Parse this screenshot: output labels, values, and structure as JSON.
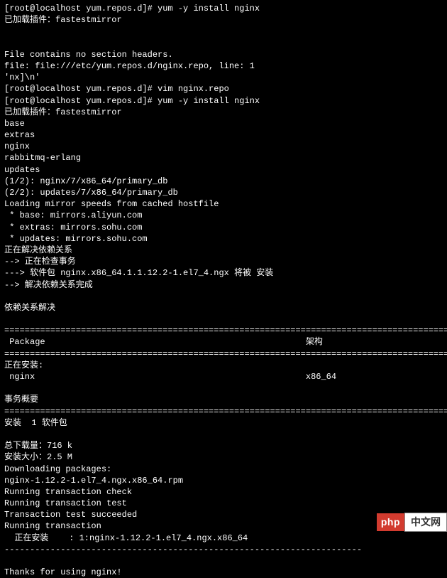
{
  "lines": {
    "l1": "[root@localhost yum.repos.d]# yum -y install nginx",
    "l2": "已加载插件：fastestmirror",
    "l3": "File contains no section headers.",
    "l4": "file: file:///etc/yum.repos.d/nginx.repo, line: 1",
    "l5": "'nx]\\n'",
    "l6": "[root@localhost yum.repos.d]# vim nginx.repo",
    "l7": "[root@localhost yum.repos.d]# yum -y install nginx",
    "l8": "已加载插件：fastestmirror",
    "l9": "base",
    "l10": "extras",
    "l11": "nginx",
    "l12": "rabbitmq-erlang",
    "l13": "updates",
    "l14": "(1/2): nginx/7/x86_64/primary_db",
    "l15": "(2/2): updates/7/x86_64/primary_db",
    "l16": "Loading mirror speeds from cached hostfile",
    "l17": " * base: mirrors.aliyun.com",
    "l18": " * extras: mirrors.sohu.com",
    "l19": " * updates: mirrors.sohu.com",
    "l20": "正在解决依赖关系",
    "l21": "--> 正在检查事务",
    "l22": "---> 软件包 nginx.x86_64.1.1.12.2-1.el7_4.ngx 将被 安装",
    "l23": "--> 解决依赖关系完成",
    "l24": "依赖关系解决",
    "l25": "=============================================================================================",
    "l26": " Package                                                   架构",
    "l27": "=============================================================================================",
    "l28": "正在安装:",
    "l29": " nginx                                                     x86_64",
    "l30": "事务概要",
    "l31": "=============================================================================================",
    "l32": "安装  1 软件包",
    "l33": "总下载量：716 k",
    "l34": "安装大小：2.5 M",
    "l35": "Downloading packages:",
    "l36": "nginx-1.12.2-1.el7_4.ngx.x86_64.rpm",
    "l37": "Running transaction check",
    "l38": "Running transaction test",
    "l39": "Transaction test succeeded",
    "l40": "Running transaction",
    "l41": "  正在安装    : 1:nginx-1.12.2-1.el7_4.ngx.x86_64",
    "l42": "----------------------------------------------------------------------",
    "l43": "Thanks for using nginx!"
  },
  "watermark": {
    "left": "php",
    "right": "中文网"
  }
}
